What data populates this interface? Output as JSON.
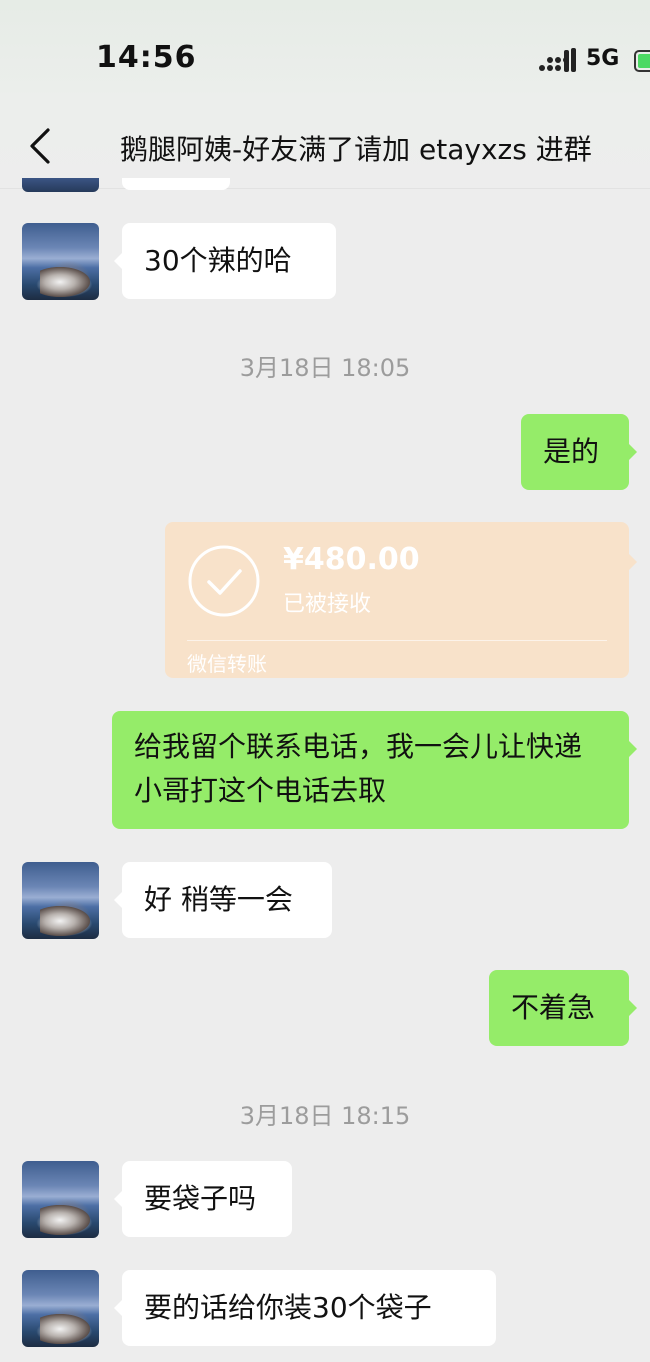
{
  "status_bar": {
    "time": "14:56",
    "network": "5G",
    "icons": [
      "signal-icon",
      "battery-icon"
    ]
  },
  "nav": {
    "back_icon": "back-chevron-icon",
    "title": "鹅腿阿姨-好友满了请加 etayxzs 进群"
  },
  "messages": {
    "m1": "30个辣的哈",
    "ts1": "3月18日 18:05",
    "m2": "是的",
    "transfer": {
      "amount": "¥480.00",
      "status": "已被接收",
      "footer": "微信转账",
      "color": "#f8e2ca"
    },
    "m3": "给我留个联系电话，我一会儿让快递小哥打这个电话去取",
    "m4": "好 稍等一会",
    "m5": "不着急",
    "ts2": "3月18日 18:15",
    "m6": "要袋子吗",
    "m7": "要的话给你装30个袋子"
  },
  "colors": {
    "background": "#ededed",
    "outgoing_bubble": "#95ec69",
    "incoming_bubble": "#ffffff",
    "timestamp": "#9c9c9c"
  }
}
